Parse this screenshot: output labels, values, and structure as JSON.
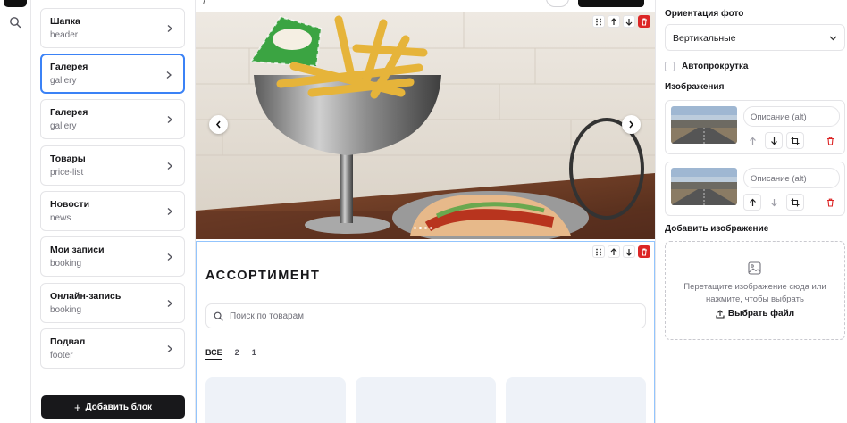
{
  "blocks": {
    "items": [
      {
        "title": "Шапка",
        "subtitle": "header"
      },
      {
        "title": "Галерея",
        "subtitle": "gallery"
      },
      {
        "title": "Галерея",
        "subtitle": "gallery"
      },
      {
        "title": "Товары",
        "subtitle": "price-list"
      },
      {
        "title": "Новости",
        "subtitle": "news"
      },
      {
        "title": "Мои записи",
        "subtitle": "booking"
      },
      {
        "title": "Онлайн-запись",
        "subtitle": "booking"
      },
      {
        "title": "Подвал",
        "subtitle": "footer"
      }
    ],
    "add_block_label": "Добавить блок"
  },
  "canvas": {
    "breadcrumb": "/",
    "section_title": "АССОРТИМЕНТ",
    "search_placeholder": "Поиск по товарам",
    "tabs": [
      "ВСЕ",
      "2",
      "1"
    ]
  },
  "props": {
    "orientation_label": "Ориентация фото",
    "orientation_value": "Вертикальные",
    "autoscroll_label": "Автопрокрутка",
    "images_label": "Изображения",
    "alt_placeholder": "Описание (alt)",
    "add_image_label": "Добавить изображение",
    "dropzone_text": "Перетащите изображение сюда или нажмите, чтобы выбрать",
    "choose_file_label": "Выбрать файл"
  },
  "colors": {
    "accent_blue": "#3b82f6",
    "danger_red": "#dc2626",
    "dark": "#18181b"
  }
}
